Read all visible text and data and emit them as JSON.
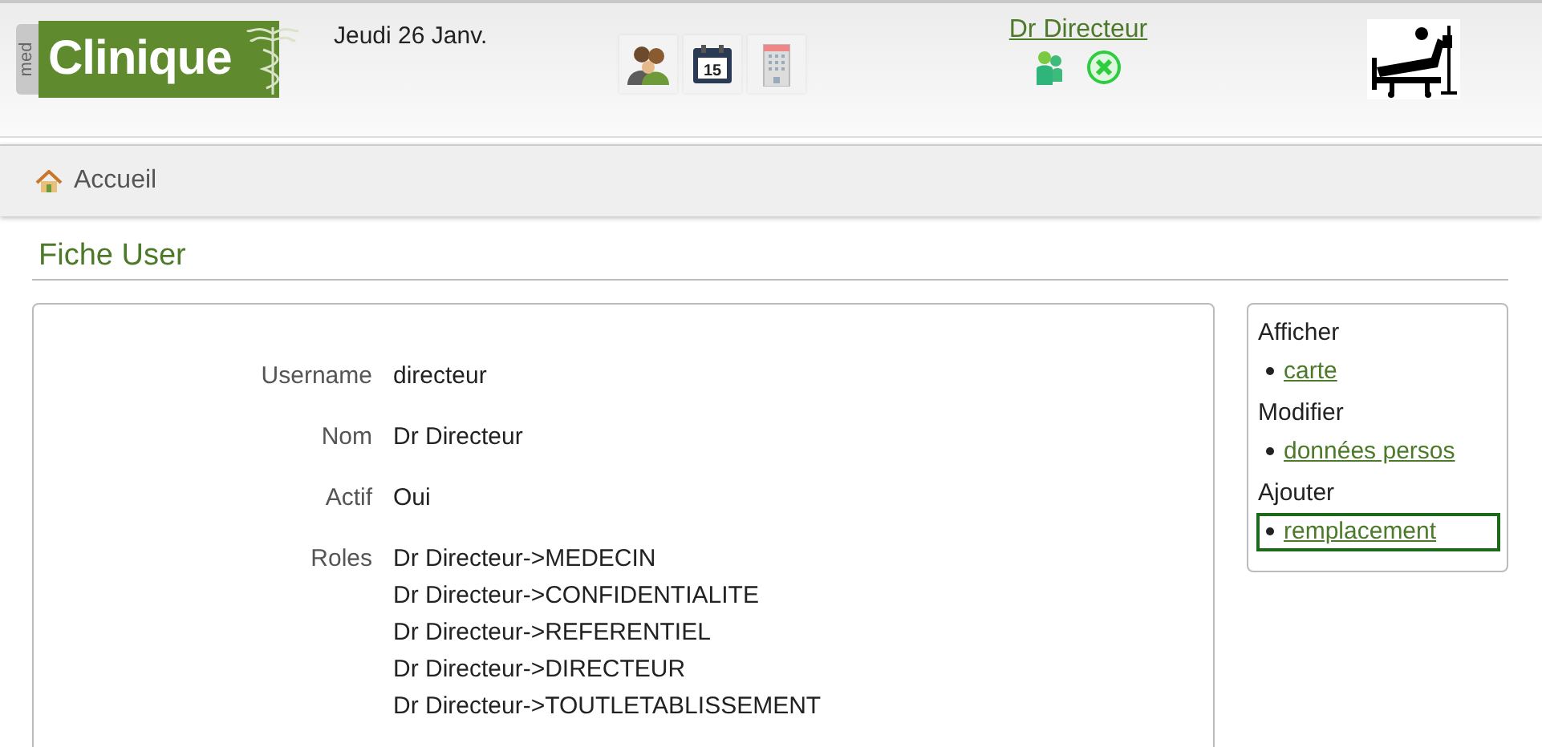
{
  "header": {
    "logo": {
      "prefix": "med",
      "name": "Clinique"
    },
    "date": "Jeudi 26 Janv.",
    "calendar_day": "15",
    "user": "Dr Directeur"
  },
  "breadcrumb": [
    {
      "label": "Accueil"
    }
  ],
  "page_title": "Fiche User",
  "fields": [
    {
      "label": "Username",
      "values": [
        "directeur"
      ]
    },
    {
      "label": "Nom",
      "values": [
        "Dr Directeur"
      ]
    },
    {
      "label": "Actif",
      "values": [
        "Oui"
      ]
    },
    {
      "label": "Roles",
      "values": [
        "Dr Directeur->MEDECIN",
        "Dr Directeur->CONFIDENTIALITE",
        "Dr Directeur->REFERENTIEL",
        "Dr Directeur->DIRECTEUR",
        "Dr Directeur->TOUTLETABLISSEMENT"
      ]
    }
  ],
  "actions": [
    {
      "heading": "Afficher",
      "links": [
        {
          "label": "carte",
          "focused": false
        }
      ]
    },
    {
      "heading": "Modifier",
      "links": [
        {
          "label": "données persos",
          "focused": false
        }
      ]
    },
    {
      "heading": "Ajouter",
      "links": [
        {
          "label": "remplacement",
          "focused": true
        }
      ]
    }
  ]
}
